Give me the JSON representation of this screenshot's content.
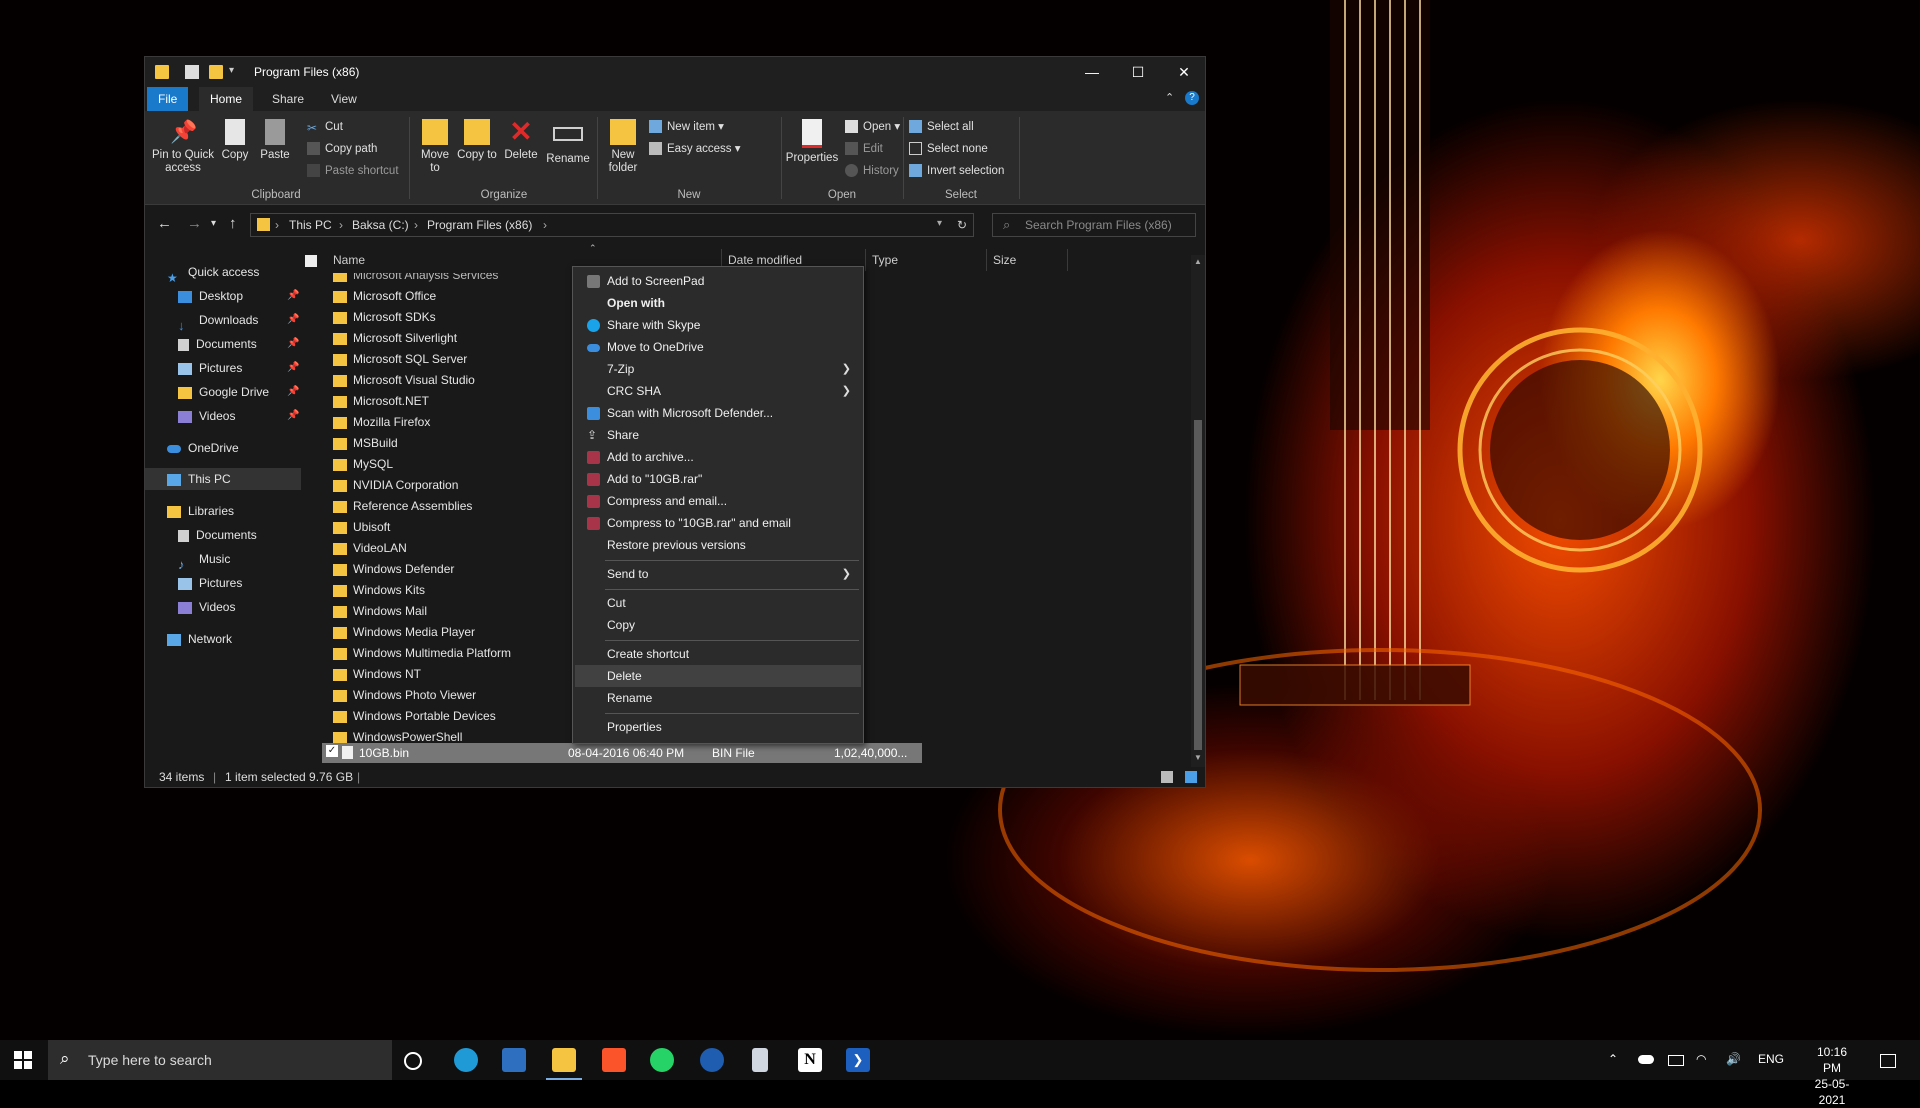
{
  "window": {
    "title": "Program Files (x86)",
    "tabs": [
      "File",
      "Home",
      "Share",
      "View"
    ],
    "controls": {
      "minimize": "—",
      "maximize": "☐",
      "close": "✕"
    }
  },
  "ribbon": {
    "clipboard": {
      "group_label": "Clipboard",
      "pin_label": "Pin to Quick access",
      "copy_label": "Copy",
      "paste_label": "Paste",
      "cut_label": "Cut",
      "copy_path_label": "Copy path",
      "paste_shortcut_label": "Paste shortcut"
    },
    "organize": {
      "group_label": "Organize",
      "move_to_label": "Move to",
      "copy_to_label": "Copy to",
      "delete_label": "Delete",
      "rename_label": "Rename"
    },
    "new": {
      "group_label": "New",
      "new_folder_label": "New folder",
      "new_item_label": "New item",
      "easy_access_label": "Easy access"
    },
    "open": {
      "group_label": "Open",
      "properties_label": "Properties",
      "open_label": "Open",
      "edit_label": "Edit",
      "history_label": "History"
    },
    "select": {
      "group_label": "Select",
      "select_all_label": "Select all",
      "select_none_label": "Select none",
      "invert_selection_label": "Invert selection"
    }
  },
  "address": {
    "crumbs": [
      "This PC",
      "Baksa (C:)",
      "Program Files (x86)"
    ],
    "search_placeholder": "Search Program Files (x86)"
  },
  "nav_pane": {
    "quick_access": "Quick access",
    "quick_items": [
      "Desktop",
      "Downloads",
      "Documents",
      "Pictures",
      "Google Drive",
      "Videos"
    ],
    "onedrive": "OneDrive",
    "this_pc": "This PC",
    "libraries": "Libraries",
    "library_items": [
      "Documents",
      "Music",
      "Pictures",
      "Videos"
    ],
    "network": "Network"
  },
  "file_list": {
    "columns": {
      "name": "Name",
      "date": "Date modified",
      "type": "Type",
      "size": "Size"
    },
    "partial_top": "Microsoft Analysis Services",
    "folders": [
      "Microsoft Office",
      "Microsoft SDKs",
      "Microsoft Silverlight",
      "Microsoft SQL Server",
      "Microsoft Visual Studio",
      "Microsoft.NET",
      "Mozilla Firefox",
      "MSBuild",
      "MySQL",
      "NVIDIA Corporation",
      "Reference Assemblies",
      "Ubisoft",
      "VideoLAN",
      "Windows Defender",
      "Windows Kits",
      "Windows Mail",
      "Windows Media Player",
      "Windows Multimedia Platform",
      "Windows NT",
      "Windows Photo Viewer",
      "Windows Portable Devices",
      "WindowsPowerShell"
    ],
    "selected_file": {
      "name": "10GB.bin",
      "date": "08-04-2016 06:40 PM",
      "type": "BIN File",
      "size": "1,02,40,000..."
    }
  },
  "status": {
    "items": "34 items",
    "selected": "1 item selected  9.76 GB"
  },
  "context_menu": {
    "add_screenpad": "Add to ScreenPad",
    "open_with": "Open with",
    "share_skype": "Share with Skype",
    "move_onedrive": "Move to OneDrive",
    "seven_zip": "7-Zip",
    "crc_sha": "CRC SHA",
    "scan_defender": "Scan with Microsoft Defender...",
    "share": "Share",
    "add_archive": "Add to archive...",
    "add_rar": "Add to \"10GB.rar\"",
    "compress_email": "Compress and email...",
    "compress_rar_email": "Compress to \"10GB.rar\" and email",
    "restore_versions": "Restore previous versions",
    "send_to": "Send to",
    "cut": "Cut",
    "copy": "Copy",
    "create_shortcut": "Create shortcut",
    "delete": "Delete",
    "rename": "Rename",
    "properties": "Properties"
  },
  "taskbar": {
    "search_placeholder": "Type here to search",
    "language": "ENG",
    "time": "10:16 PM",
    "date": "25-05-2021"
  }
}
